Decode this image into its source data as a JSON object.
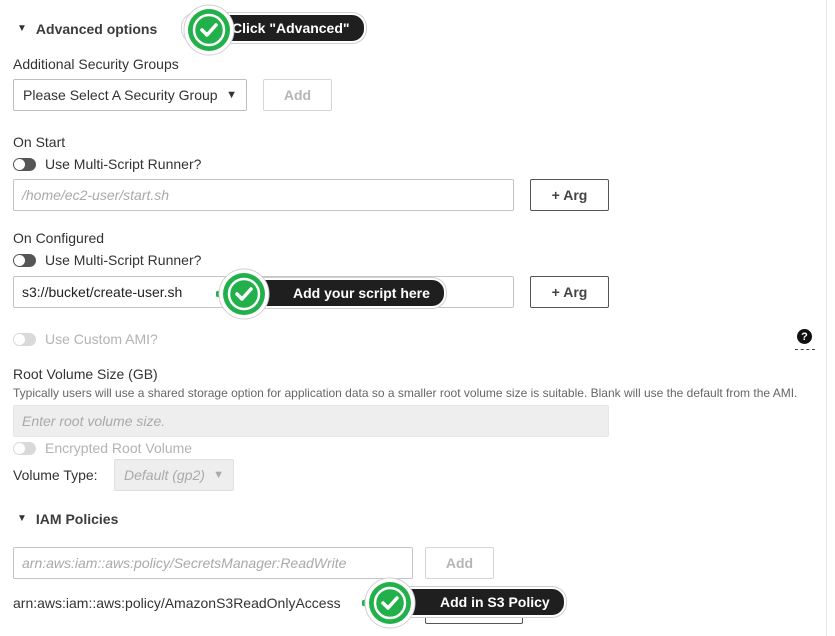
{
  "advanced": {
    "title": "Advanced options",
    "security_groups": {
      "label": "Additional Security Groups",
      "select_value": "Please Select A Security Group",
      "add_label": "Add"
    },
    "on_start": {
      "label": "On Start",
      "toggle_label": "Use Multi-Script Runner?",
      "placeholder": "/home/ec2-user/start.sh",
      "arg_label": "+ Arg"
    },
    "on_configured": {
      "label": "On Configured",
      "toggle_label": "Use Multi-Script Runner?",
      "value": "s3://bucket/create-user.sh",
      "arg_label": "+ Arg"
    },
    "custom_ami": {
      "toggle_label": "Use Custom AMI?",
      "help_glyph": "?"
    },
    "root_volume": {
      "label": "Root Volume Size (GB)",
      "help": "Typically users will use a shared storage option for application data so a smaller root volume size is suitable. Blank will use the default from the AMI.",
      "placeholder": "Enter root volume size.",
      "encrypted_label": "Encrypted Root Volume",
      "volume_type_label": "Volume Type:",
      "volume_type_value": "Default (gp2)"
    }
  },
  "iam": {
    "title": "IAM Policies",
    "placeholder": "arn:aws:iam::aws:policy/SecretsManager:ReadWrite",
    "add_label": "Add",
    "policies": [
      "arn:aws:iam::aws:policy/AmazonS3ReadOnlyAccess"
    ]
  },
  "callouts": {
    "advanced": "Click \"Advanced\"",
    "script": "Add your script here",
    "policy": "Add in S3 Policy"
  },
  "colors": {
    "callout_bg": "#1f1f1f",
    "check_green": "#22b04b",
    "toggle_on": "#555555"
  },
  "icons": {
    "collapse": "triangle-down-icon",
    "select_caret": "triangle-down-icon",
    "check": "check-circle-icon",
    "help": "question-circle-icon"
  }
}
